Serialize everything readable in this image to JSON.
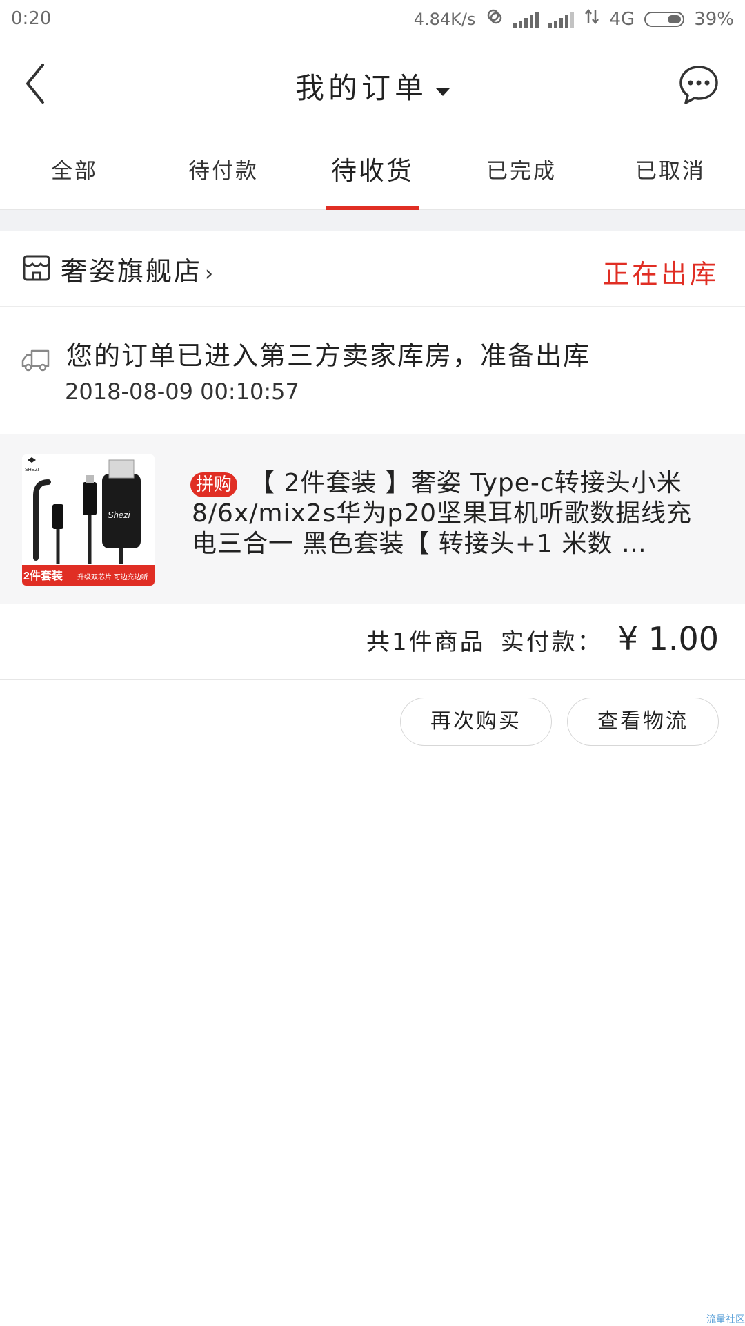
{
  "status_bar": {
    "time": "0:20",
    "speed": "4.84K/s",
    "network": "4G",
    "battery_percent": "39%",
    "battery_level": 0.39,
    "icons": [
      "hotspot-icon",
      "signal-icon",
      "signal-icon",
      "data-arrows-icon",
      "battery-icon"
    ]
  },
  "header": {
    "title": "我的订单",
    "back_icon": "back-arrow-icon",
    "caret_icon": "caret-down-icon",
    "chat_icon": "chat-bubble-icon"
  },
  "tabs": [
    {
      "label": "全部",
      "active": false
    },
    {
      "label": "待付款",
      "active": false
    },
    {
      "label": "待收货",
      "active": true
    },
    {
      "label": "已完成",
      "active": false
    },
    {
      "label": "已取消",
      "active": false
    }
  ],
  "order": {
    "store_name": "奢姿旗舰店",
    "store_chevron": "›",
    "store_icon": "store-icon",
    "status": "正在出库",
    "logistics_icon": "truck-icon",
    "logistics_text": "您的订单已进入第三方卖家库房，准备出库",
    "logistics_time": "2018-08-09 00:10:57",
    "product": {
      "tag": "拼购",
      "title": "【 2件套装 】奢姿 Type-c转接头小米8/6x/mix2s华为p20坚果耳机听歌数据线充电三合一 黑色套装【 转接头+1 米数 …",
      "thumb_brand": "SHEZI",
      "thumb_badge_main": "2件套装",
      "thumb_badge_sub": "升级双芯片 可边充边听"
    },
    "summary_count": "共1件商品",
    "summary_label": "实付款：",
    "summary_price": "¥ 1.00"
  },
  "actions": {
    "buy_again": "再次购买",
    "view_logistics": "查看物流"
  },
  "watermark": "流量社区",
  "colors": {
    "accent": "#e02e24",
    "band": "#f1f2f4",
    "product_bg": "#f6f6f7"
  }
}
